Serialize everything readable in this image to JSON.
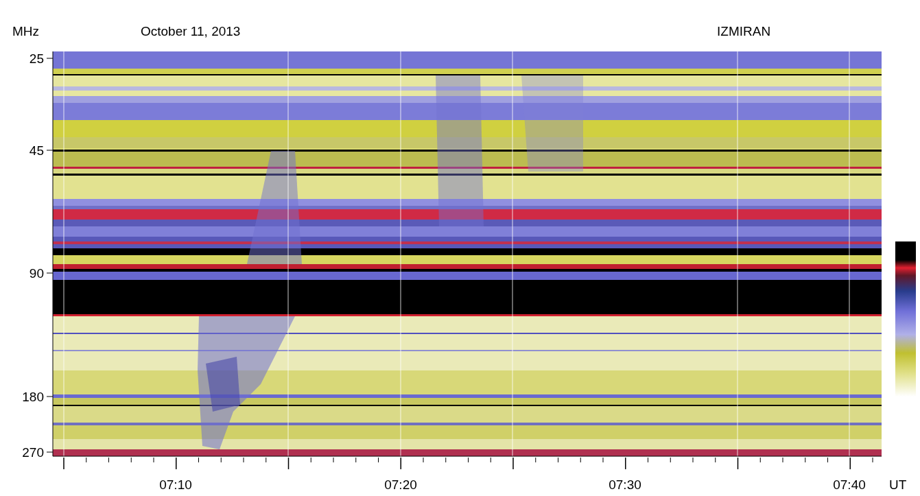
{
  "header": {
    "frequency_unit": "MHz",
    "date": "October 11, 2013",
    "observatory": "IZMIRAN"
  },
  "y_axis": {
    "ticks": [
      "25",
      "45",
      "90",
      "180",
      "270"
    ]
  },
  "x_axis": {
    "ticks": [
      "07:10",
      "07:20",
      "07:30",
      "07:40"
    ],
    "unit": "UT"
  }
}
